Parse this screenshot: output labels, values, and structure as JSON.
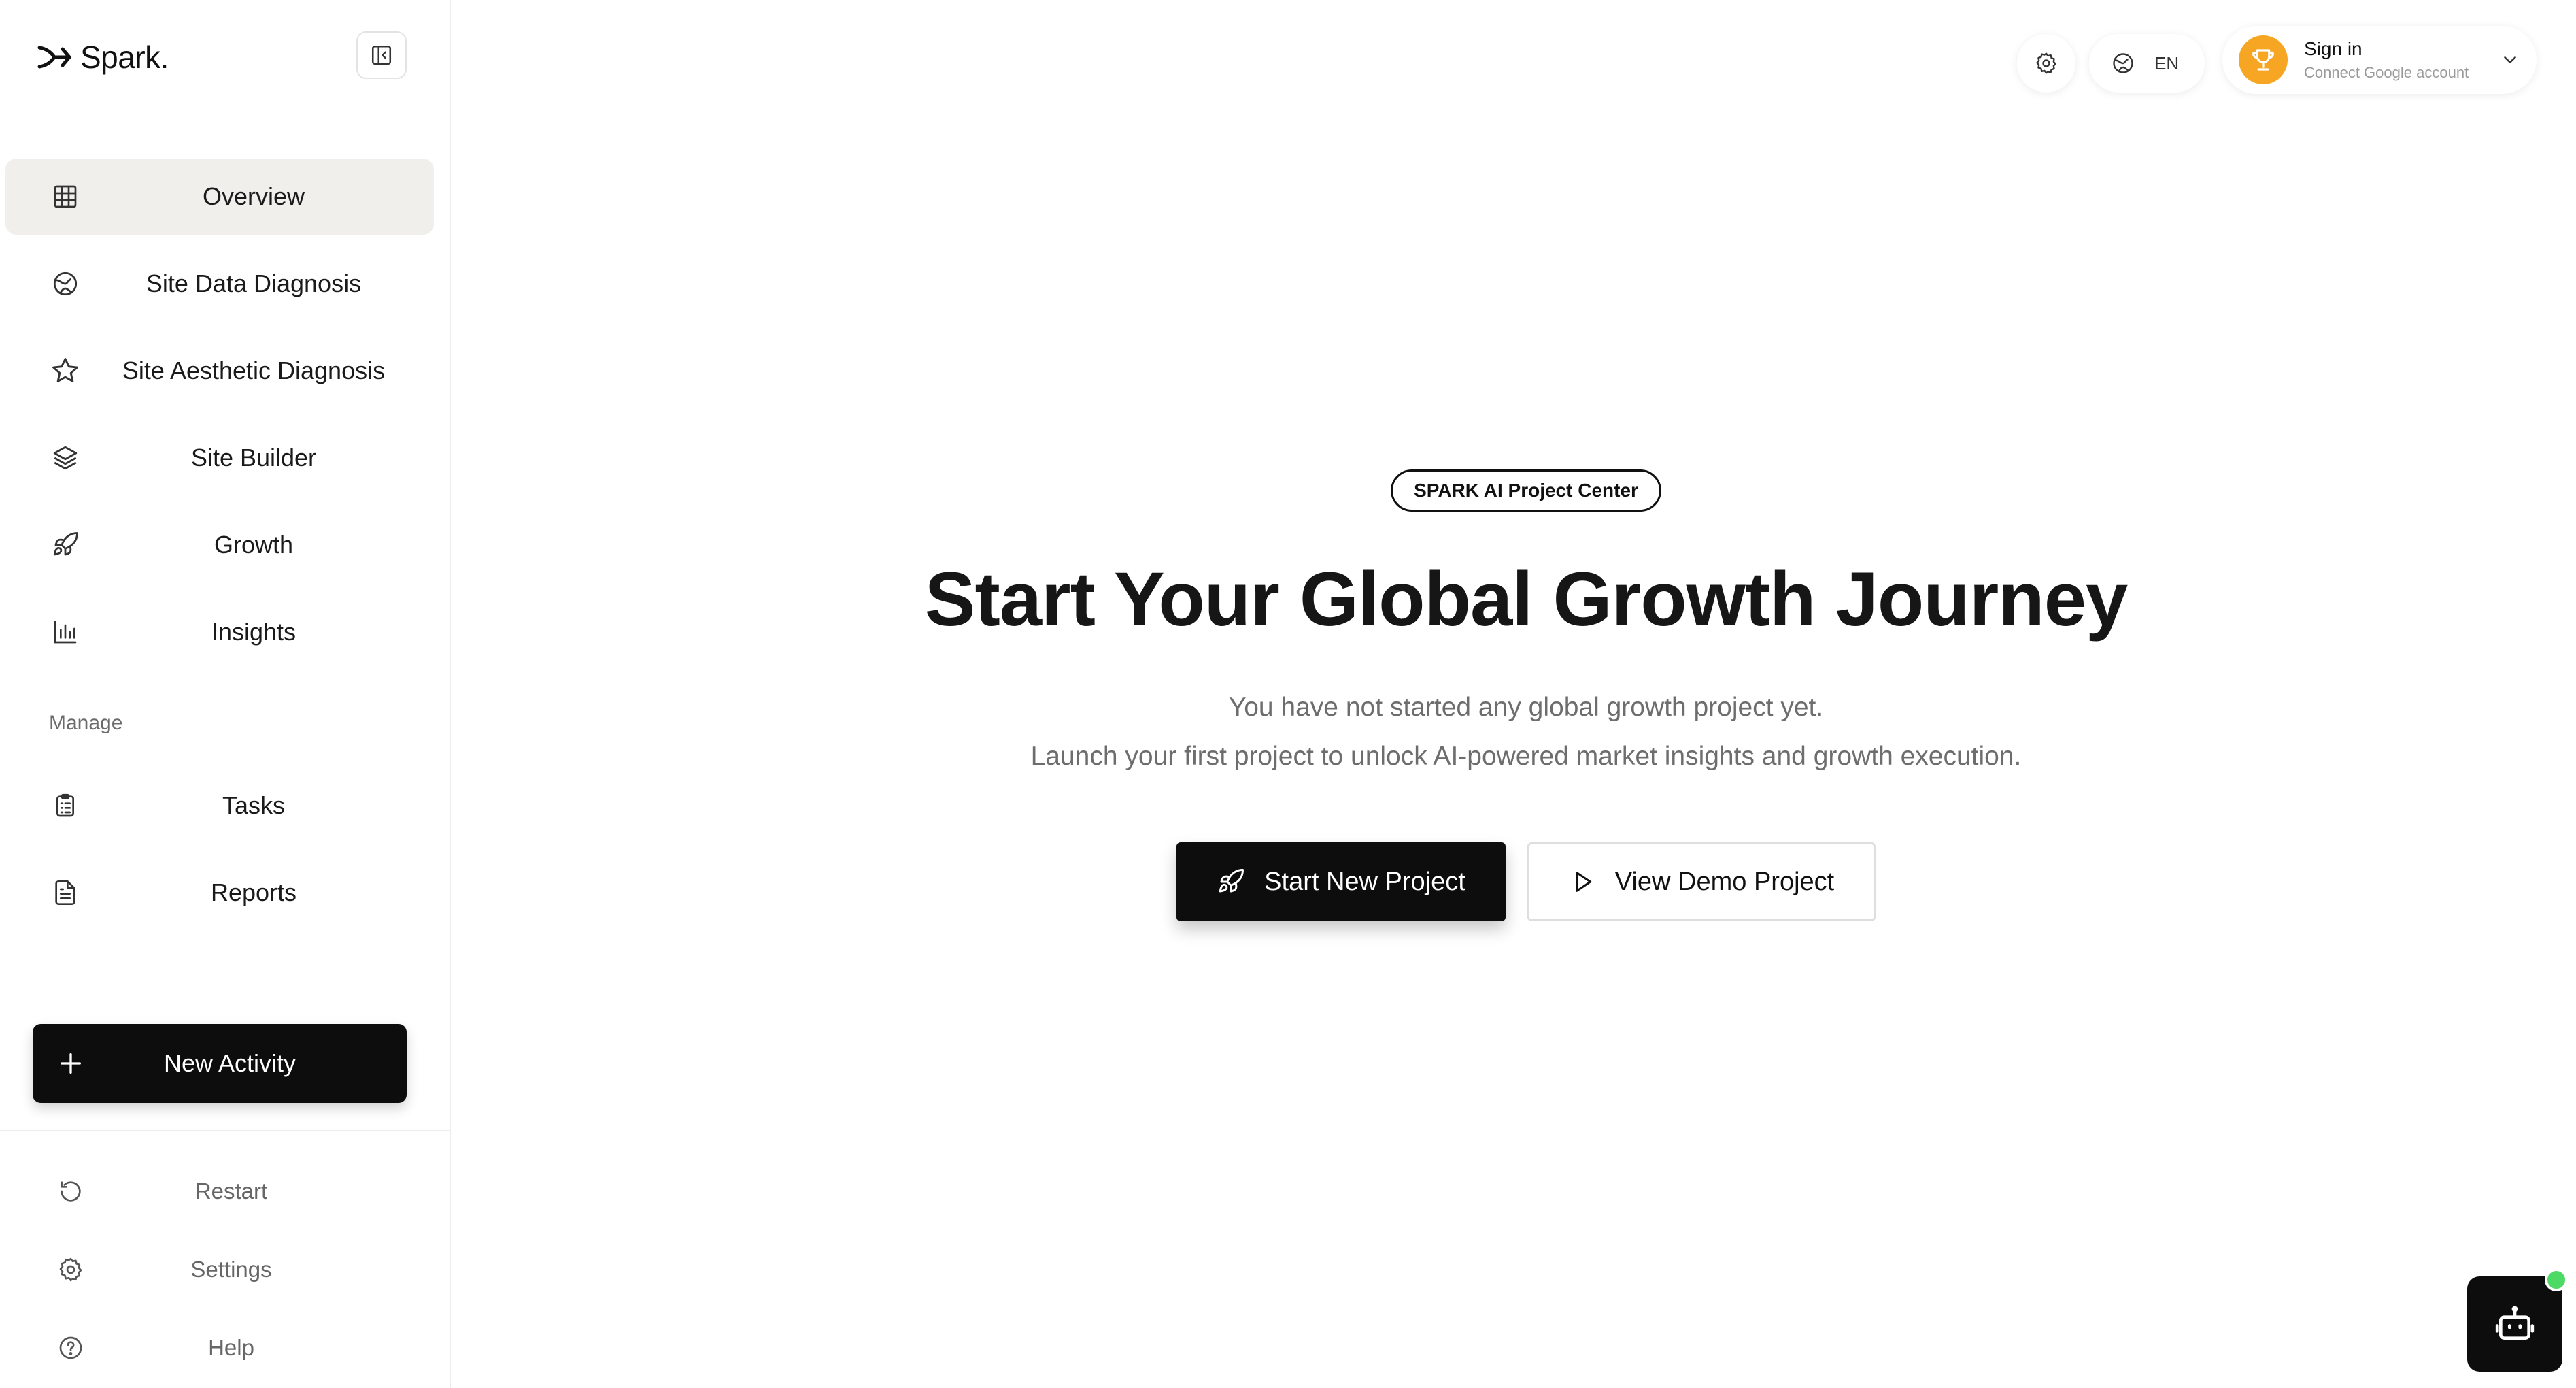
{
  "brand": {
    "name": "Spark."
  },
  "sidebar": {
    "items": [
      {
        "label": "Overview",
        "icon": "grid-icon",
        "active": true
      },
      {
        "label": "Site Data Diagnosis",
        "icon": "globe-icon"
      },
      {
        "label": "Site Aesthetic Diagnosis",
        "icon": "star-icon"
      },
      {
        "label": "Site Builder",
        "icon": "layers-icon"
      },
      {
        "label": "Growth",
        "icon": "rocket-icon"
      },
      {
        "label": "Insights",
        "icon": "bar-chart-icon"
      }
    ],
    "manage_label": "Manage",
    "manage_items": [
      {
        "label": "Tasks",
        "icon": "clipboard-icon"
      },
      {
        "label": "Reports",
        "icon": "document-icon"
      }
    ],
    "new_activity_label": "New Activity",
    "footer": [
      {
        "label": "Restart",
        "icon": "restart-icon"
      },
      {
        "label": "Settings",
        "icon": "gear-icon"
      },
      {
        "label": "Help",
        "icon": "help-icon"
      }
    ]
  },
  "topbar": {
    "language": "EN",
    "account": {
      "title": "Sign in",
      "subtitle": "Connect Google account"
    }
  },
  "hero": {
    "badge": "SPARK AI Project Center",
    "title": "Start Your Global Growth Journey",
    "subtitle_line1": "You have not started any global growth project yet.",
    "subtitle_line2": "Launch your first project to unlock AI-powered market insights and growth execution.",
    "primary_button": "Start New Project",
    "secondary_button": "View Demo Project"
  },
  "colors": {
    "accent_dark": "#0d0d0d",
    "active_nav_bg": "#f1efec",
    "trophy": "#f6a623",
    "online_dot": "#4cd964"
  }
}
